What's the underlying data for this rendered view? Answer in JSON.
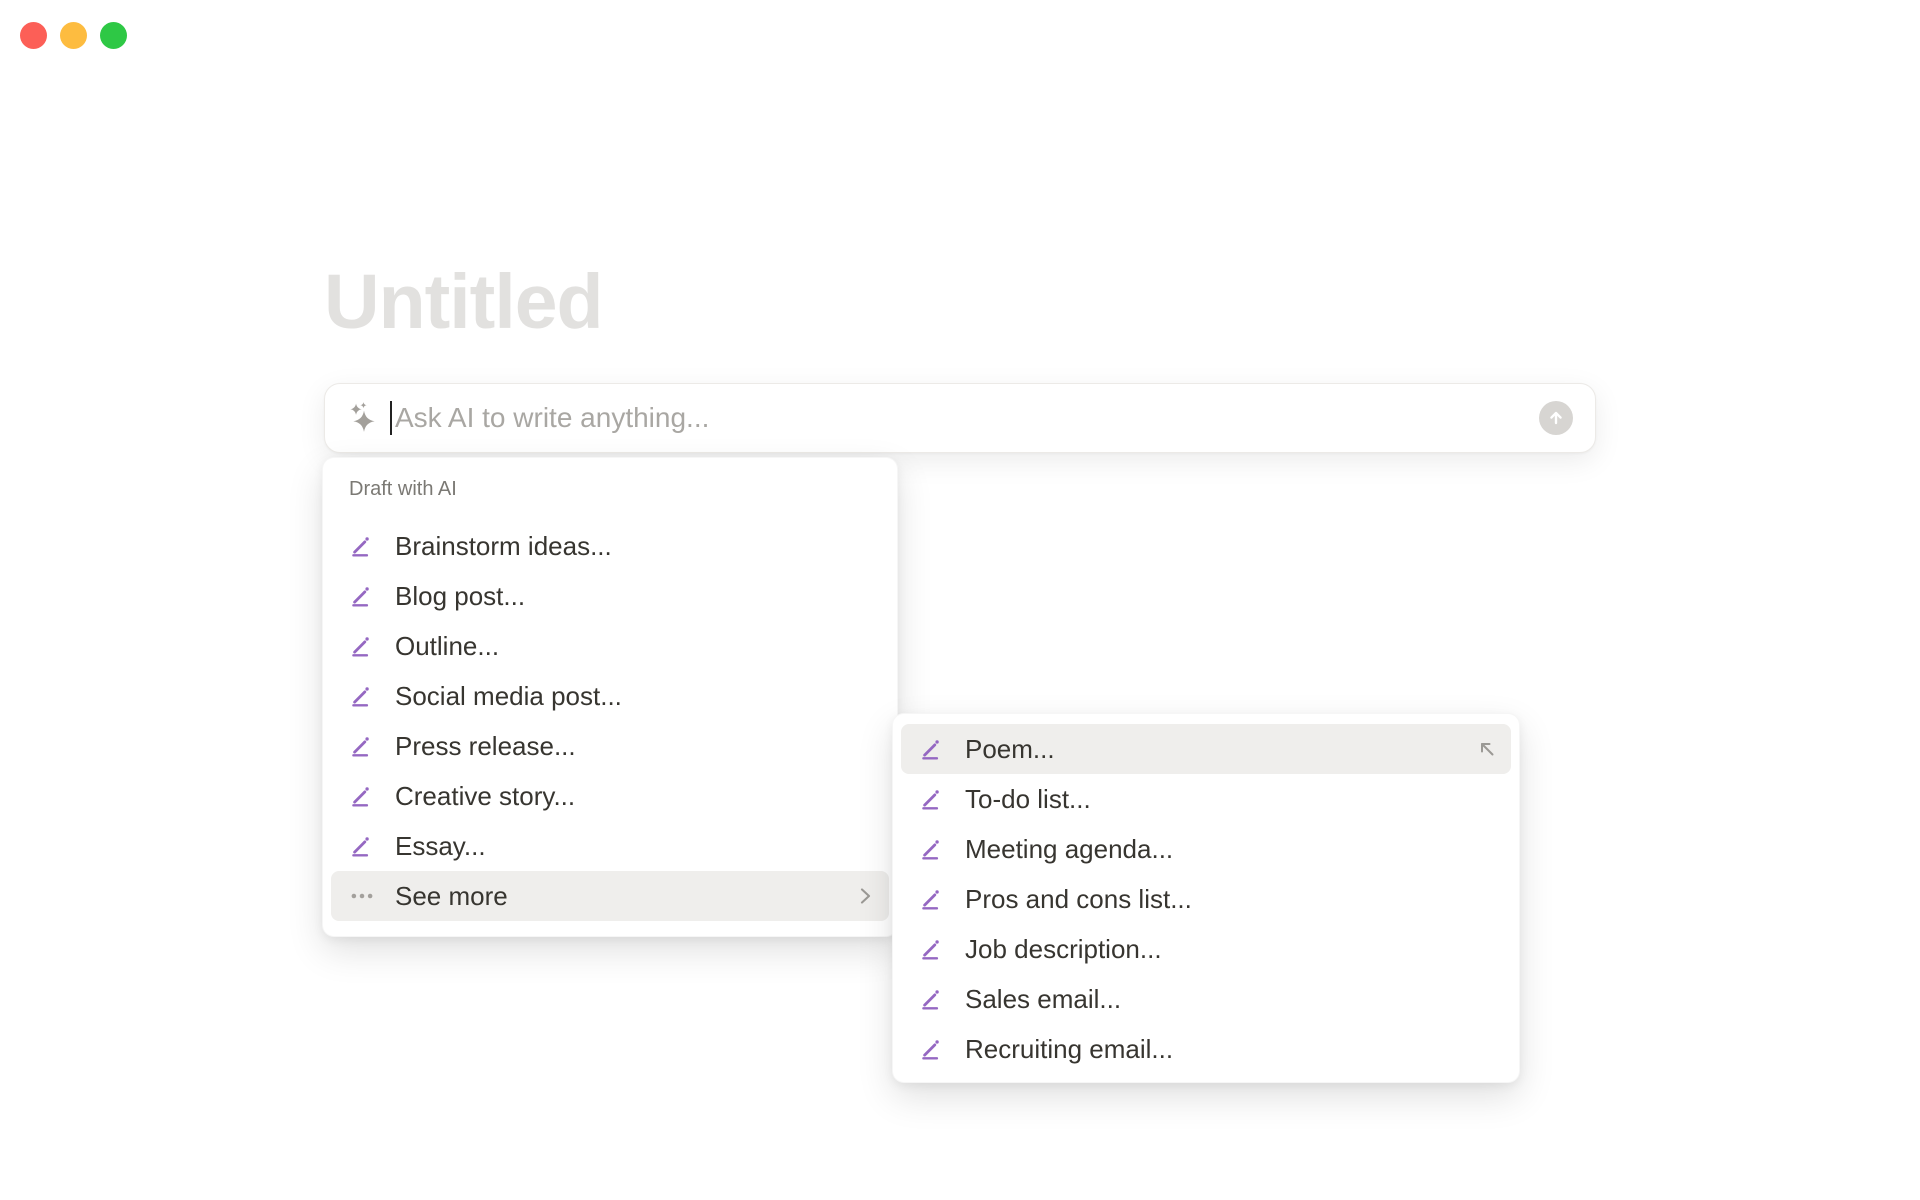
{
  "window": {
    "controls": [
      {
        "name": "close",
        "color": "#FC5F57"
      },
      {
        "name": "minimize",
        "color": "#FDBC40"
      },
      {
        "name": "zoom",
        "color": "#2EC845"
      }
    ]
  },
  "page": {
    "title_placeholder": "Untitled"
  },
  "ai_bar": {
    "placeholder": "Ask AI to write anything...",
    "leading_icon": "ai-sparkle-icon",
    "submit_icon": "arrow-up-icon"
  },
  "draft_menu": {
    "header": "Draft with AI",
    "items": [
      {
        "label": "Brainstorm ideas...",
        "icon": "pencil-icon"
      },
      {
        "label": "Blog post...",
        "icon": "pencil-icon"
      },
      {
        "label": "Outline...",
        "icon": "pencil-icon"
      },
      {
        "label": "Social media post...",
        "icon": "pencil-icon"
      },
      {
        "label": "Press release...",
        "icon": "pencil-icon"
      },
      {
        "label": "Creative story...",
        "icon": "pencil-icon"
      },
      {
        "label": "Essay...",
        "icon": "pencil-icon"
      }
    ],
    "see_more": {
      "label": "See more",
      "icon": "ellipsis-icon",
      "trailing_icon": "chevron-right-icon",
      "highlighted": true
    }
  },
  "submenu": {
    "items": [
      {
        "label": "Poem...",
        "icon": "pencil-icon",
        "selected": true,
        "trailing_icon": "arrow-up-left-icon"
      },
      {
        "label": "To-do list...",
        "icon": "pencil-icon"
      },
      {
        "label": "Meeting agenda...",
        "icon": "pencil-icon"
      },
      {
        "label": "Pros and cons list...",
        "icon": "pencil-icon"
      },
      {
        "label": "Job description...",
        "icon": "pencil-icon"
      },
      {
        "label": "Sales email...",
        "icon": "pencil-icon"
      },
      {
        "label": "Recruiting email...",
        "icon": "pencil-icon"
      }
    ]
  },
  "colors": {
    "accent_purple": "#9568C2",
    "highlight_gray": "#EFEEEC",
    "text_primary": "#373530",
    "text_muted": "#7B7974",
    "placeholder_gray": "#A9A7A3",
    "title_placeholder_gray": "#E2E1DF",
    "send_button_gray": "#D7D5D2"
  }
}
